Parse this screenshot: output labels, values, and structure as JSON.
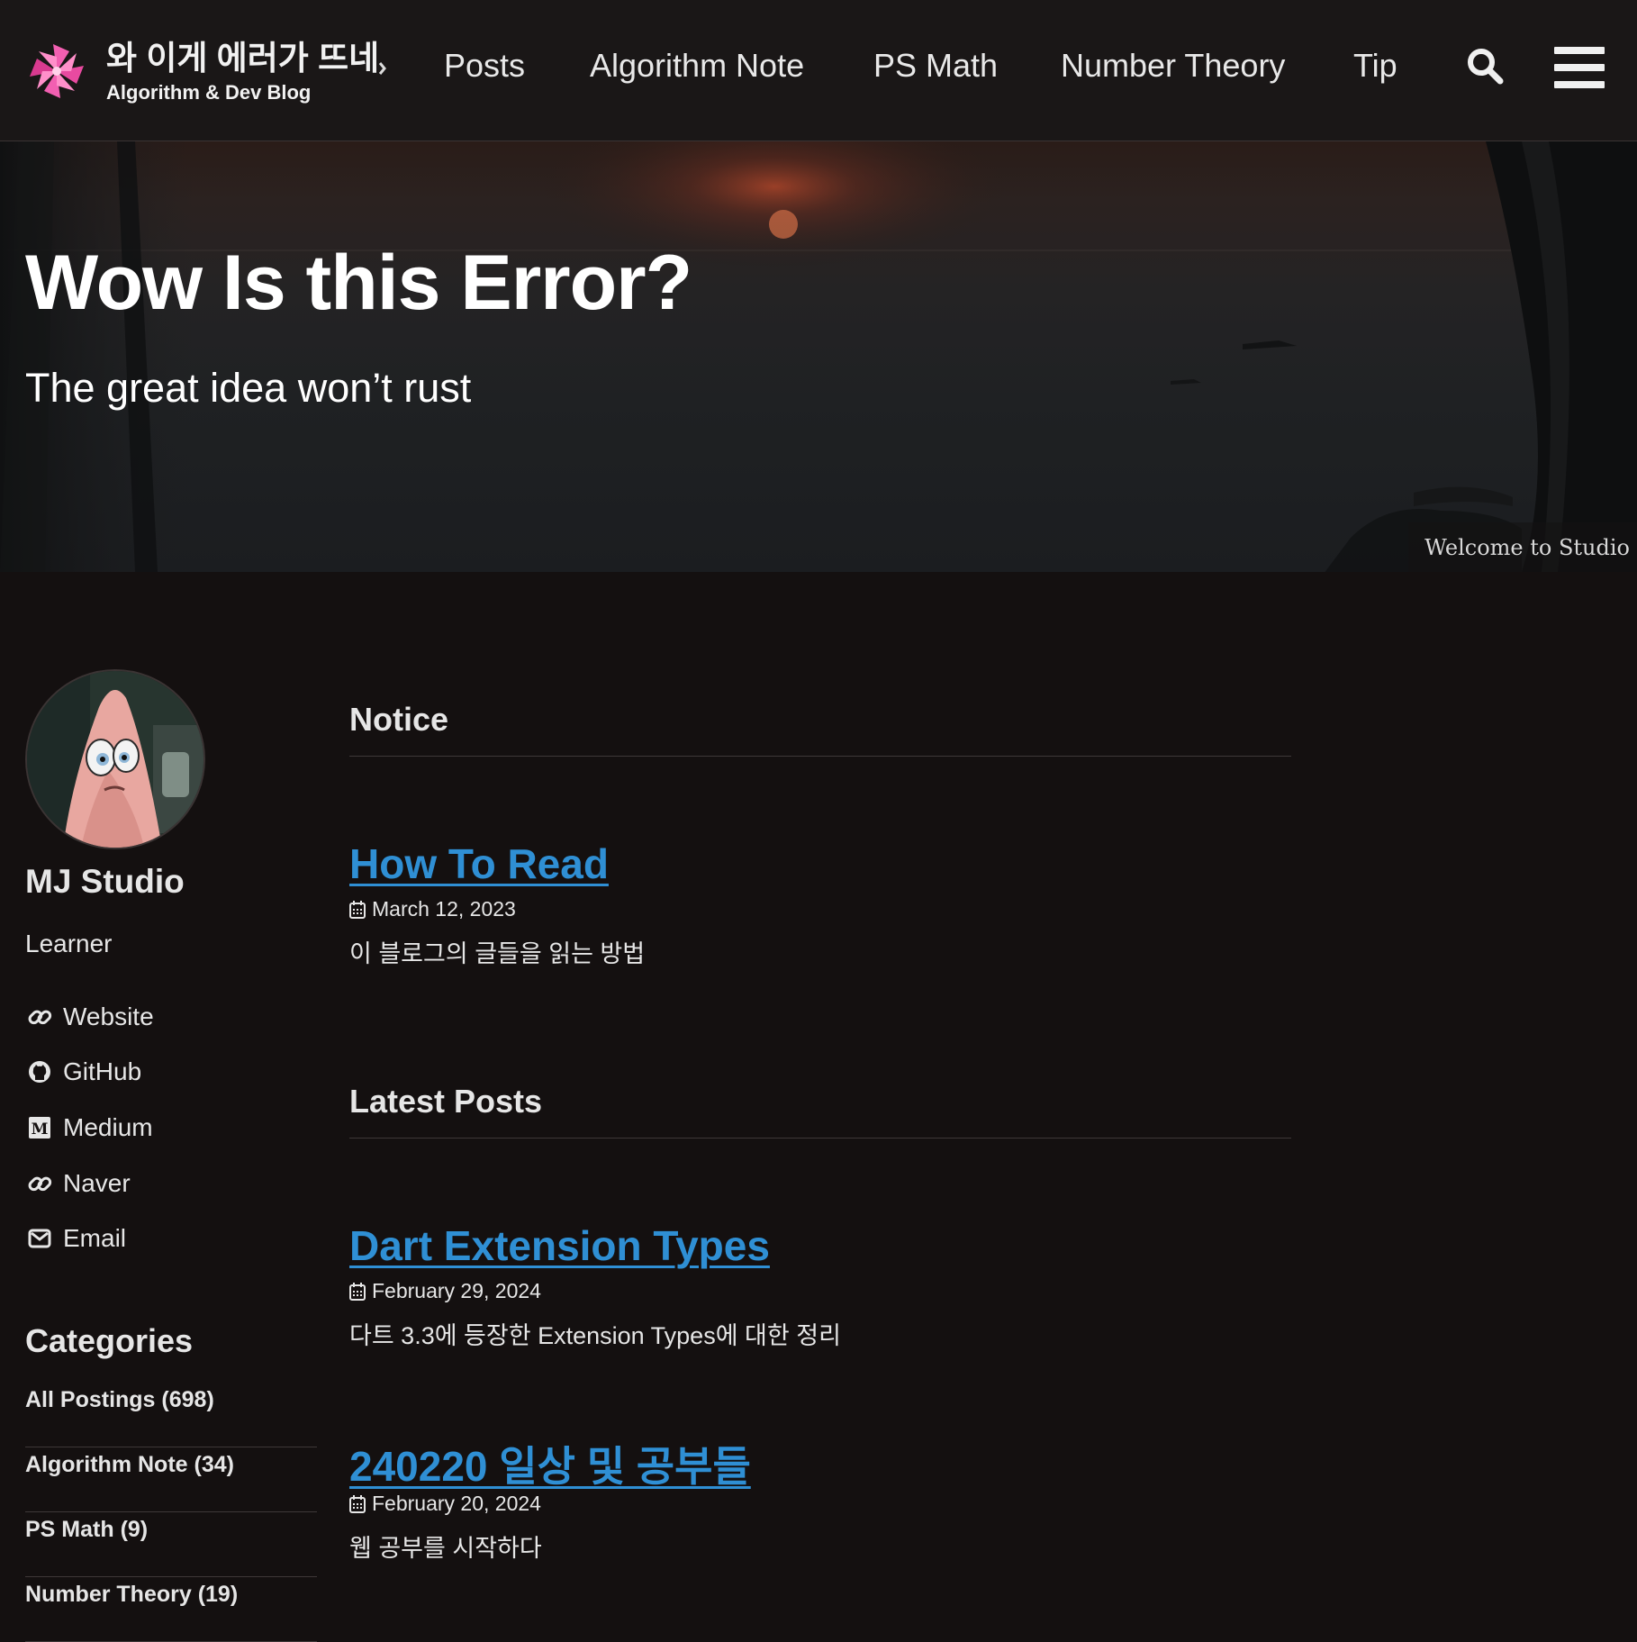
{
  "header": {
    "site_title": "와 이게 에러가 뜨네",
    "site_subtitle": "Algorithm & Dev Blog",
    "nav": [
      "Posts",
      "Algorithm Note",
      "PS Math",
      "Number Theory",
      "Tip"
    ]
  },
  "hero": {
    "title": "Wow Is this Error?",
    "tagline": "The great idea won’t rust",
    "caption": "Welcome to Studio"
  },
  "author": {
    "name": "MJ Studio",
    "bio": "Learner",
    "links": [
      {
        "label": "Website",
        "icon": "link-icon"
      },
      {
        "label": "GitHub",
        "icon": "github-icon"
      },
      {
        "label": "Medium",
        "icon": "medium-icon"
      },
      {
        "label": "Naver",
        "icon": "link-icon"
      },
      {
        "label": "Email",
        "icon": "email-icon"
      }
    ]
  },
  "categories": {
    "title": "Categories",
    "items": [
      "All Postings (698)",
      "Algorithm Note (34)",
      "PS Math (9)",
      "Number Theory (19)"
    ]
  },
  "notice": {
    "title": "Notice",
    "posts": [
      {
        "title": "How To Read",
        "date": "March 12, 2023",
        "excerpt": "이 블로그의 글들을 읽는 방법"
      }
    ]
  },
  "latest": {
    "title": "Latest Posts",
    "posts": [
      {
        "title": "Dart Extension Types",
        "date": "February 29, 2024",
        "excerpt": "다트 3.3에 등장한 Extension Types에 대한 정리"
      },
      {
        "title": "240220 일상 및 공부들",
        "date": "February 20, 2024",
        "excerpt": "웹 공부를 시작하다"
      }
    ]
  },
  "colors": {
    "background": "#141010",
    "link": "#2f8fd4",
    "logo": "#e84aa0"
  }
}
